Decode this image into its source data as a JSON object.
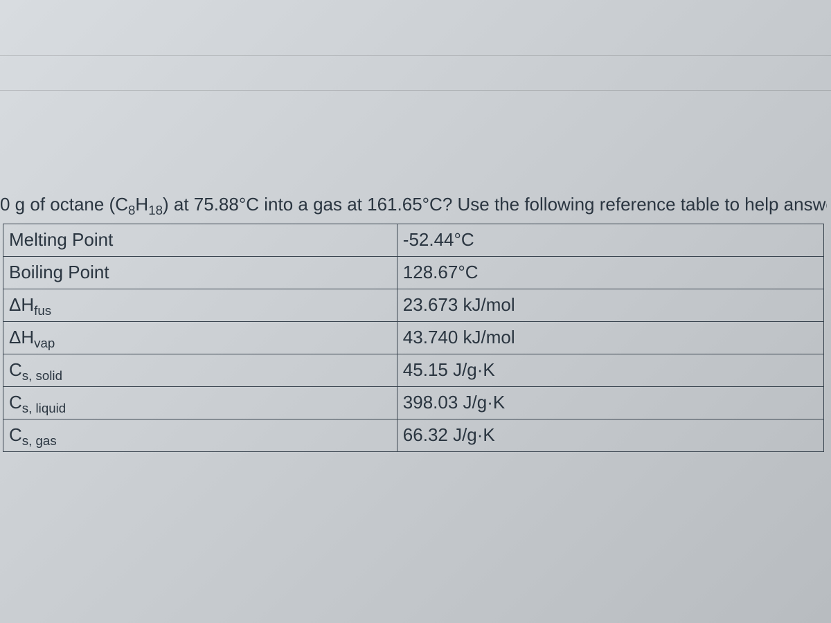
{
  "question": {
    "prefix": "0 g of octane (C",
    "sub1": "8",
    "mid1": "H",
    "sub2": "18",
    "rest": ") at 75.88°C into a gas at 161.65°C?  Use the following reference table to help answer thi"
  },
  "table": {
    "rows": [
      {
        "label_plain": "Melting Point",
        "value": "-52.44°C"
      },
      {
        "label_plain": "Boiling Point",
        "value": "128.67°C"
      },
      {
        "label_delta": "ΔH",
        "label_sub": "fus",
        "value": "23.673 kJ/mol"
      },
      {
        "label_delta": "ΔH",
        "label_sub": "vap",
        "value": "43.740 kJ/mol"
      },
      {
        "label_delta": "C",
        "label_sub": "s, solid",
        "value": "45.15 J/g·K"
      },
      {
        "label_delta": "C",
        "label_sub": "s, liquid",
        "value": "398.03 J/g·K"
      },
      {
        "label_delta": "C",
        "label_sub": "s, gas",
        "value": "66.32 J/g·K"
      }
    ]
  }
}
